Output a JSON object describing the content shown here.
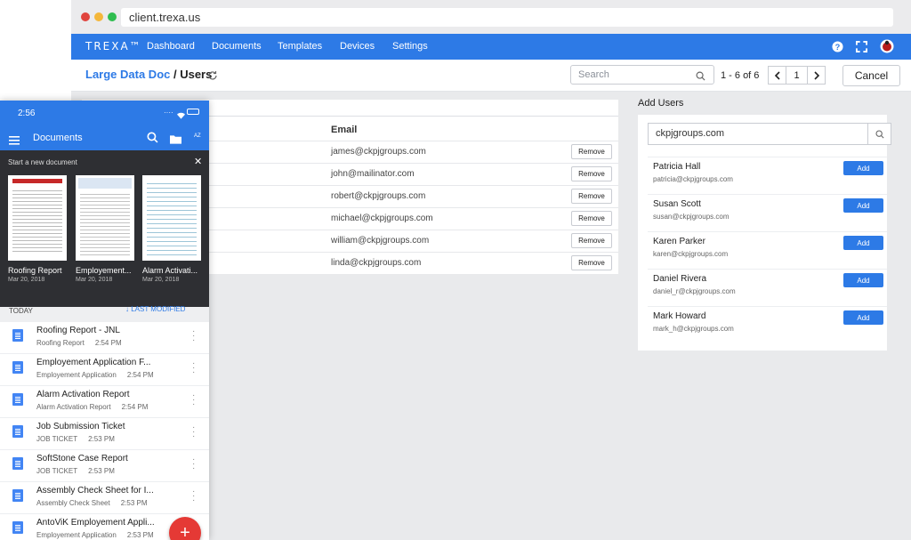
{
  "browser": {
    "url": "client.trexa.us",
    "dots": [
      "#e0443e",
      "#f4b73b",
      "#2fbd50"
    ]
  },
  "app": {
    "logo": "TREXA™",
    "nav": [
      "Dashboard",
      "Documents",
      "Templates",
      "Devices",
      "Settings"
    ],
    "accent": "#2d7ae6"
  },
  "subbar": {
    "crumb_doc": "Large Data Doc",
    "crumb_sep": " / Users",
    "search_placeholder": "Search",
    "pager_text": "1 - 6 of 6",
    "page": "1",
    "cancel": "Cancel"
  },
  "users": {
    "email_header": "Email",
    "remove_label": "Remove",
    "rows": [
      "james@ckpjgroups.com",
      "john@mailinator.com",
      "robert@ckpjgroups.com",
      "michael@ckpjgroups.com",
      "william@ckpjgroups.com",
      "linda@ckpjgroups.com"
    ]
  },
  "add_users": {
    "title": "Add Users",
    "search_value": "ckpjgroups.com",
    "add_label": "Add",
    "rows": [
      {
        "name": "Patricia Hall",
        "email": "patricia@ckpjgroups.com"
      },
      {
        "name": "Susan Scott",
        "email": "susan@ckpjgroups.com"
      },
      {
        "name": "Karen Parker",
        "email": "karen@ckpjgroups.com"
      },
      {
        "name": "Daniel Rivera",
        "email": "daniel_r@ckpjgroups.com"
      },
      {
        "name": "Mark Howard",
        "email": "mark_h@ckpjgroups.com"
      }
    ]
  },
  "phone": {
    "time": "2:56",
    "title": "Documents",
    "start_text": "Start a new document",
    "templates": [
      {
        "name": "Roofing Report",
        "date": "Mar 20, 2018"
      },
      {
        "name": "Employement...",
        "date": "Mar 20, 2018"
      },
      {
        "name": "Alarm Activati...",
        "date": "Mar 20, 2018"
      }
    ],
    "section_label": "TODAY",
    "sort_label": "↓  LAST MODIFIED",
    "docs": [
      {
        "title": "Roofing Report - JNL",
        "sub": "Roofing Report",
        "time": "2:54 PM"
      },
      {
        "title": "Employement Application F...",
        "sub": "Employement Application",
        "time": "2:54 PM"
      },
      {
        "title": "Alarm Activation Report",
        "sub": "Alarm Activation Report",
        "time": "2:54 PM"
      },
      {
        "title": "Job Submission Ticket",
        "sub": "JOB TICKET",
        "time": "2:53 PM"
      },
      {
        "title": "SoftStone Case Report",
        "sub": "JOB TICKET",
        "time": "2:53 PM"
      },
      {
        "title": "Assembly Check Sheet for I...",
        "sub": "Assembly Check Sheet",
        "time": "2:53 PM"
      },
      {
        "title": "AntoViK Employement Appli...",
        "sub": "Employement Application",
        "time": "2:53 PM"
      }
    ],
    "fab": "+"
  }
}
